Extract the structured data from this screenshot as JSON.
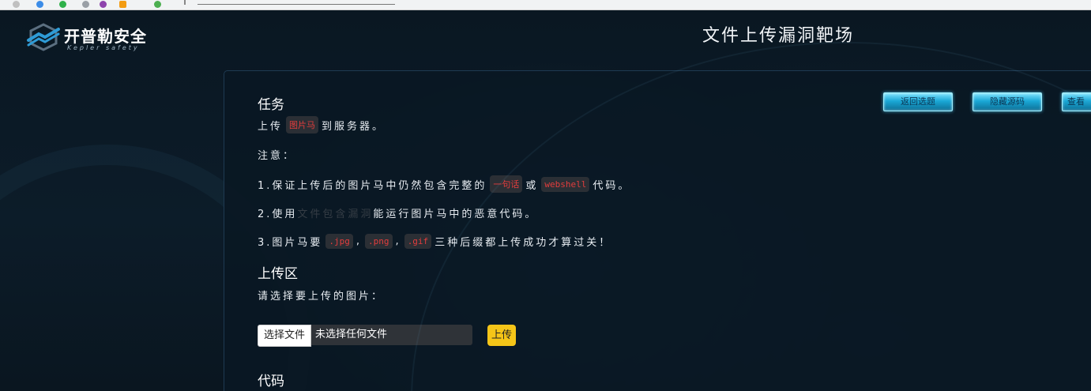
{
  "logo": {
    "name": "开普勒安全",
    "subtitle": "Kepler safety"
  },
  "header": {
    "title": "文件上传漏洞靶场"
  },
  "toolbar": {
    "back_label": "返回选题",
    "hide_source_label": "隐藏源码",
    "view_label": "查看"
  },
  "task": {
    "title": "任务",
    "line1_prefix": "上传",
    "line1_code": "图片马",
    "line1_suffix": "到服务器。",
    "note": "注意：",
    "item1_prefix": "1.保证上传后的图片马中仍然包含完整的",
    "item1_code1": "一句话",
    "item1_mid": "或",
    "item1_code2": "webshell",
    "item1_suffix": "代码。",
    "item2_prefix": "2.使用",
    "item2_dim": "文件包含漏洞",
    "item2_suffix": "能运行图片马中的恶意代码。",
    "item3_prefix": "3.图片马要",
    "item3_code1": ".jpg",
    "item3_code2": ".png",
    "item3_code3": ".gif",
    "comma": ",",
    "item3_suffix": "三种后缀都上传成功才算过关！"
  },
  "upload": {
    "title": "上传区",
    "prompt": "请选择要上传的图片：",
    "choose_label": "选择文件",
    "no_file": "未选择任何文件",
    "submit_label": "上传"
  },
  "code_section": {
    "title": "代码"
  },
  "colors": {
    "accent": "#f5c518",
    "code_text": "#e23d3d",
    "button_cyan": "#1aa8d6"
  }
}
